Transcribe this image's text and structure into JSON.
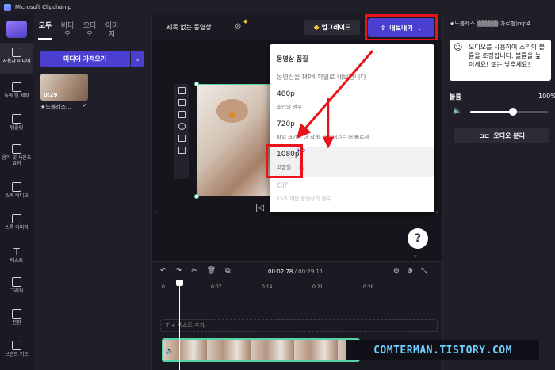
{
  "window": {
    "title": "Microsoft Clipchamp"
  },
  "nav": {
    "items": [
      {
        "label": "사용자 미디어",
        "icon": "media-icon"
      },
      {
        "label": "녹화 및 제작",
        "icon": "record-icon"
      },
      {
        "label": "템플릿",
        "icon": "templates-icon"
      },
      {
        "label": "음악 및 사운드 효과",
        "icon": "music-icon"
      },
      {
        "label": "스톡 비디오",
        "icon": "stock-video-icon"
      },
      {
        "label": "스톡 이미지",
        "icon": "stock-image-icon"
      },
      {
        "label": "텍스트",
        "icon": "text-icon"
      },
      {
        "label": "그래픽",
        "icon": "graphics-icon"
      },
      {
        "label": "전환",
        "icon": "transitions-icon"
      },
      {
        "label": "브랜드 키트",
        "icon": "brand-kit-icon"
      }
    ]
  },
  "media": {
    "tabs": [
      "모두",
      "비디오",
      "오디오",
      "이미지"
    ],
    "import_label": "미디어 가져오기",
    "thumb_duration": "0:29",
    "thumb_name": "★노블레스...",
    "thumb_check": "✓"
  },
  "topbar": {
    "project_name": "제목 없는 동영상",
    "upgrade_label": "업그레이드",
    "export_label": "내보내기"
  },
  "export_menu": {
    "title": "동영상 품질",
    "description": "동영상을 MP4 파일로 내보냅니다",
    "options": [
      {
        "name": "480p",
        "sub": "초안의 경우"
      },
      {
        "name": "720p",
        "sub": "파일 크기는 더 작게, 내보내기는 더 빠르게"
      },
      {
        "name": "1080p",
        "sub": "고품질",
        "badge": "HD"
      },
      {
        "name": "GIF",
        "sub": "15초 미만 동영상의 경우"
      }
    ],
    "selected_index": 2
  },
  "right": {
    "file_name": "★노블레스 ▒▒▒▒▒(가로형)mp4",
    "tip": "오디오를 사용하여 소리의 볼륨을 조정합니다. 볼륨을 높이세요! 또는 낮추세요!",
    "volume_label": "볼륨",
    "volume_value": "100%",
    "volume_level": 0.55,
    "detach_label": "오디오 분리"
  },
  "timeline": {
    "current_time": "00:02.78",
    "total_time": "/ 00:29.11",
    "ticks": [
      "0",
      "0:07",
      "0:14",
      "0:21",
      "0:28"
    ],
    "text_track_label": "T + 텍스트 추가"
  },
  "watermark": "COMTERMAN.TISTORY.COM",
  "colors": {
    "accent": "#4b3fd1",
    "highlight": "#e8141b",
    "selection": "#56d2a7"
  }
}
